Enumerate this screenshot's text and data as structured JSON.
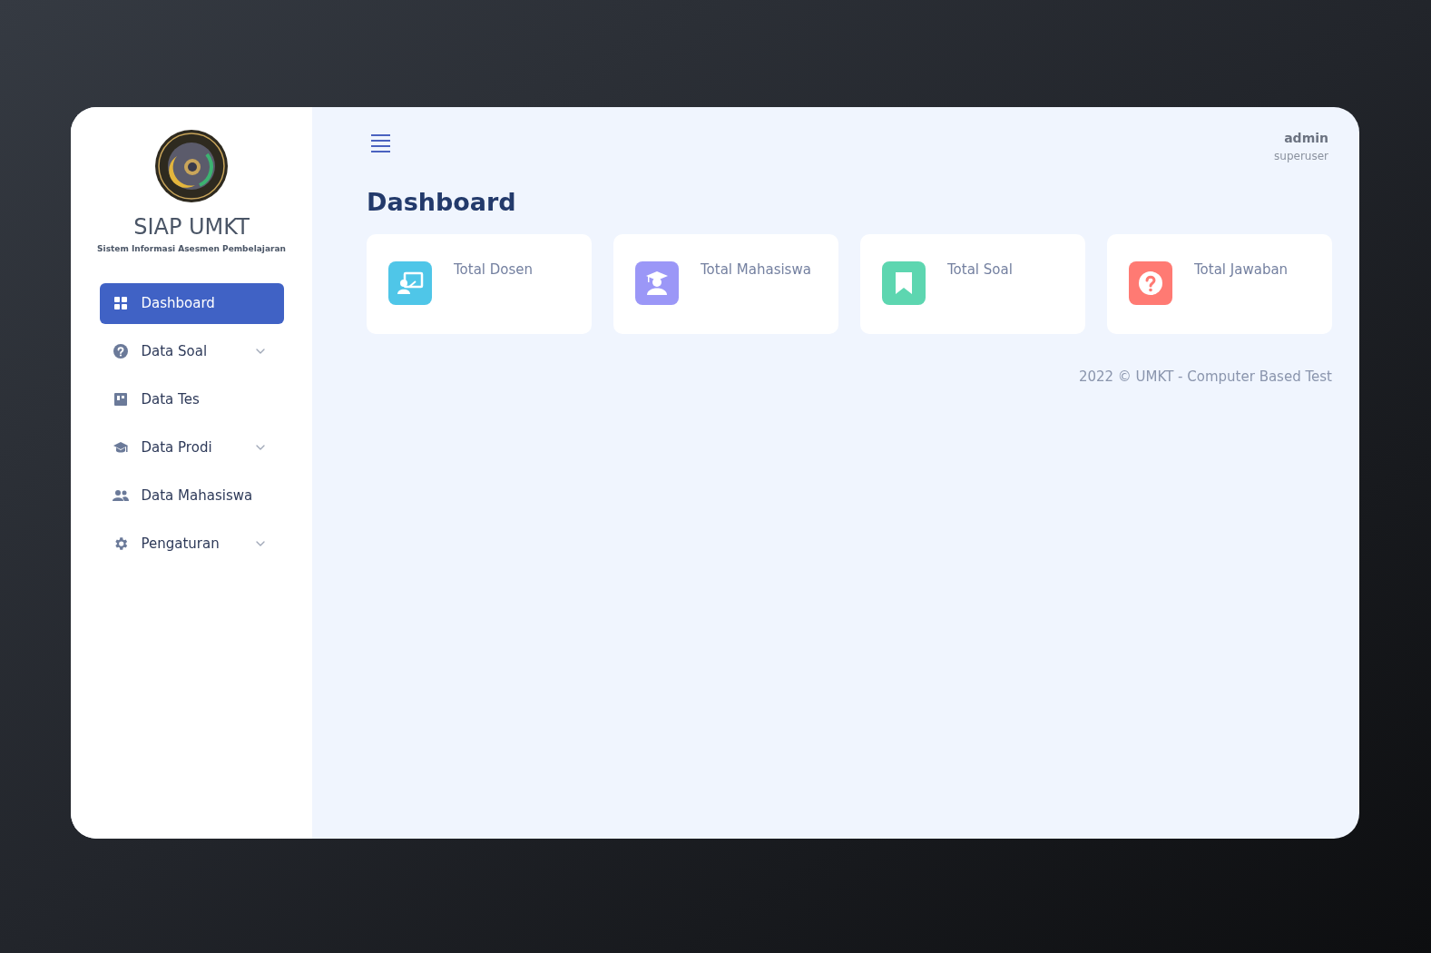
{
  "sidebar": {
    "title": "SIAP UMKT",
    "subtitle": "Sistem Informasi Asesmen Pembelajaran",
    "items": [
      {
        "label": "Dashboard",
        "selected": true,
        "expandable": false
      },
      {
        "label": "Data Soal",
        "selected": false,
        "expandable": true
      },
      {
        "label": "Data Tes",
        "selected": false,
        "expandable": false
      },
      {
        "label": "Data Prodi",
        "selected": false,
        "expandable": true
      },
      {
        "label": "Data Mahasiswa",
        "selected": false,
        "expandable": false
      },
      {
        "label": "Pengaturan",
        "selected": false,
        "expandable": true
      }
    ]
  },
  "user": {
    "name": "admin",
    "role": "superuser"
  },
  "page_title": "Dashboard",
  "stats": [
    {
      "label": "Total Dosen",
      "color": "#4fc6e8"
    },
    {
      "label": "Total Mahasiswa",
      "color": "#9b97f7"
    },
    {
      "label": "Total Soal",
      "color": "#5dd6b0"
    },
    {
      "label": "Total Jawaban",
      "color": "#ff7a73"
    }
  ],
  "footer": "2022 © UMKT - Computer Based Test"
}
